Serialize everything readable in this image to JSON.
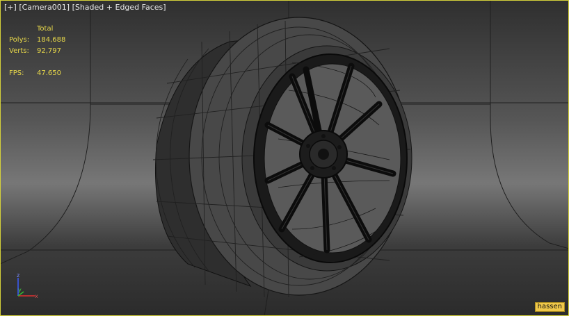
{
  "viewport": {
    "menu_plus": "[+]",
    "camera": "[Camera001]",
    "shading": "[Shaded + Edged Faces]"
  },
  "stats": {
    "header": "Total",
    "polys_label": "Polys:",
    "polys_value": "184,688",
    "verts_label": "Verts:",
    "verts_value": "92,797",
    "fps_label": "FPS:",
    "fps_value": "47.650"
  },
  "axis": {
    "x": "x",
    "y": "y",
    "z": "z"
  },
  "badge": {
    "user": "hassen"
  },
  "colors": {
    "border": "#d6d23a",
    "stats_text": "#e8d84a",
    "badge_bg": "#f0c84a"
  }
}
